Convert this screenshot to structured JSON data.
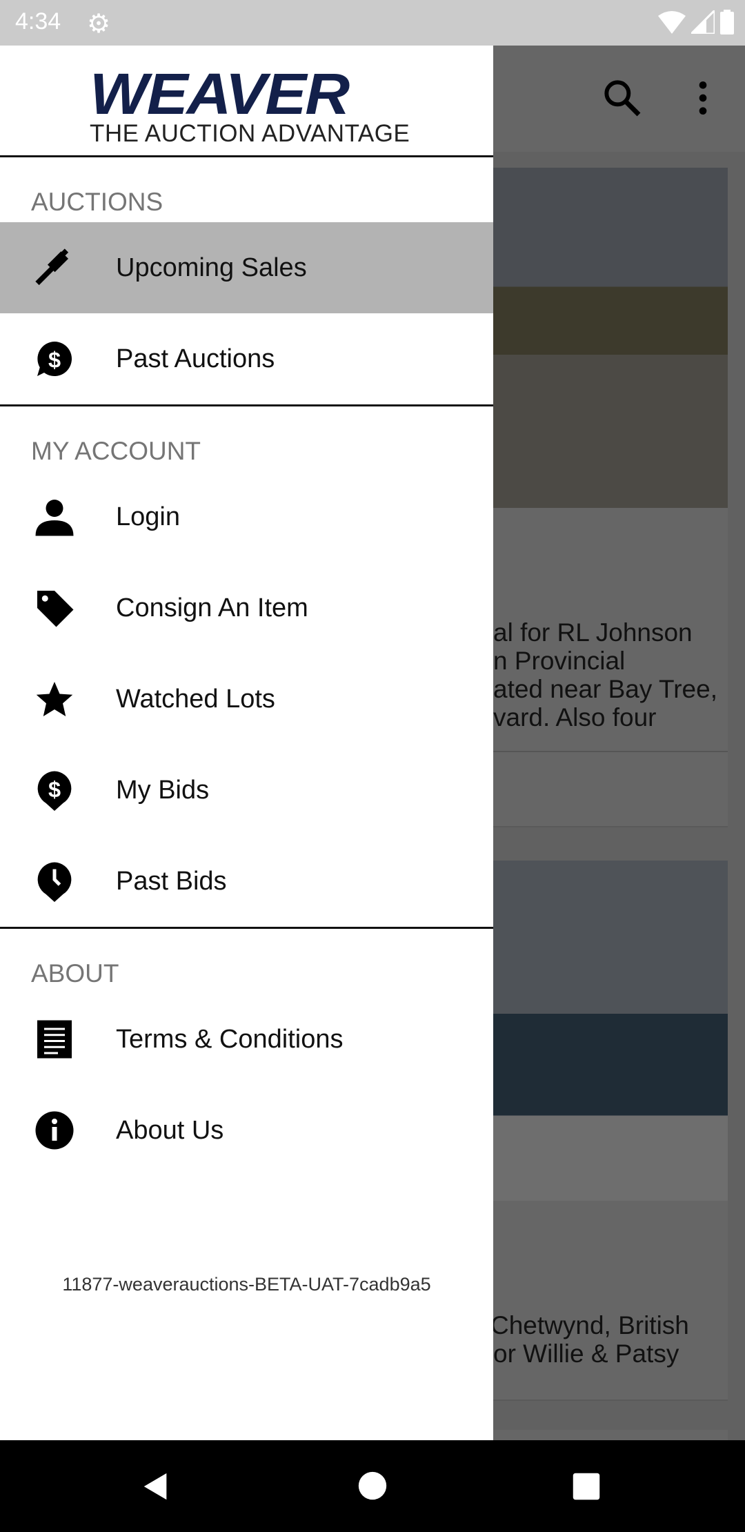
{
  "status_bar": {
    "time": "4:34",
    "icons": [
      "settings-icon",
      "wifi-icon",
      "signal-icon",
      "battery-icon"
    ]
  },
  "toolbar": {
    "icons": [
      "search-icon",
      "more-vert-icon"
    ]
  },
  "background_cards": [
    {
      "lines": [
        "al for RL Johnson",
        "n Provincial",
        "ated near Bay Tree,",
        "vard. Also four"
      ]
    },
    {
      "lines": [
        "Chetwynd, British",
        "or Willie & Patsy"
      ]
    }
  ],
  "drawer": {
    "logo": {
      "name": "WEAVER",
      "tagline": "THE AUCTION ADVANTAGE",
      "color": "#13204a"
    },
    "sections": [
      {
        "title": "AUCTIONS",
        "items": [
          {
            "label": "Upcoming Sales",
            "icon": "gavel-icon",
            "selected": true
          },
          {
            "label": "Past Auctions",
            "icon": "dollar-chat-icon"
          }
        ]
      },
      {
        "title": "MY ACCOUNT",
        "items": [
          {
            "label": "Login",
            "icon": "person-icon"
          },
          {
            "label": "Consign An Item",
            "icon": "tag-icon"
          },
          {
            "label": "Watched Lots",
            "icon": "star-icon"
          },
          {
            "label": "My Bids",
            "icon": "dollar-pin-icon"
          },
          {
            "label": "Past Bids",
            "icon": "clock-pin-icon"
          }
        ]
      },
      {
        "title": "ABOUT",
        "items": [
          {
            "label": "Terms & Conditions",
            "icon": "document-icon"
          },
          {
            "label": "About Us",
            "icon": "info-icon"
          }
        ]
      }
    ],
    "version": "11877-weaverauctions-BETA-UAT-7cadb9a5"
  },
  "nav_bar": {
    "icons": [
      "back-icon",
      "home-icon",
      "recents-icon"
    ]
  }
}
